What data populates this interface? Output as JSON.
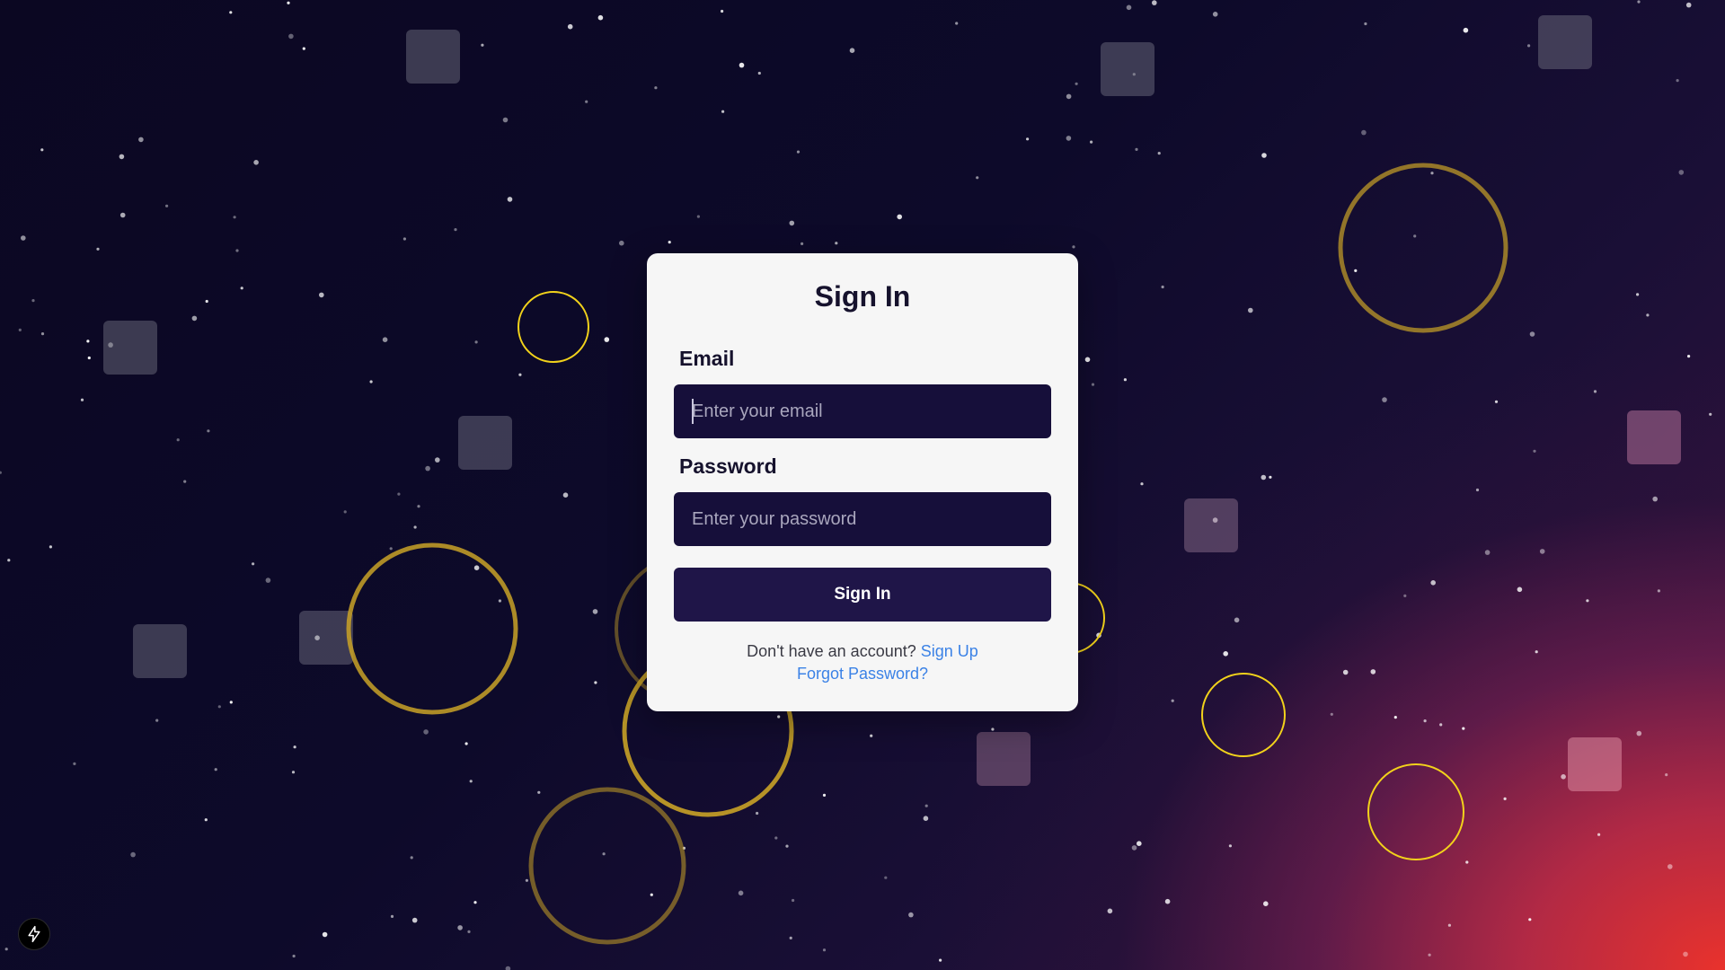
{
  "sign_in": {
    "title": "Sign In",
    "email_label": "Email",
    "email_placeholder": "Enter your email",
    "email_value": "",
    "password_label": "Password",
    "password_placeholder": "Enter your password",
    "password_value": "",
    "submit_label": "Sign In",
    "no_account_text": "Don't have an account?",
    "sign_up_link": "Sign Up",
    "forgot_password_link": "Forgot Password?"
  },
  "badge": {
    "icon": "bolt-icon"
  },
  "colors": {
    "card_background": "#f6f6f6",
    "input_background": "#160f3a",
    "button_background": "#1f1548",
    "link": "#3b82e6",
    "ring_gold": "#c9a227",
    "ring_yellow": "#f2d21b"
  }
}
